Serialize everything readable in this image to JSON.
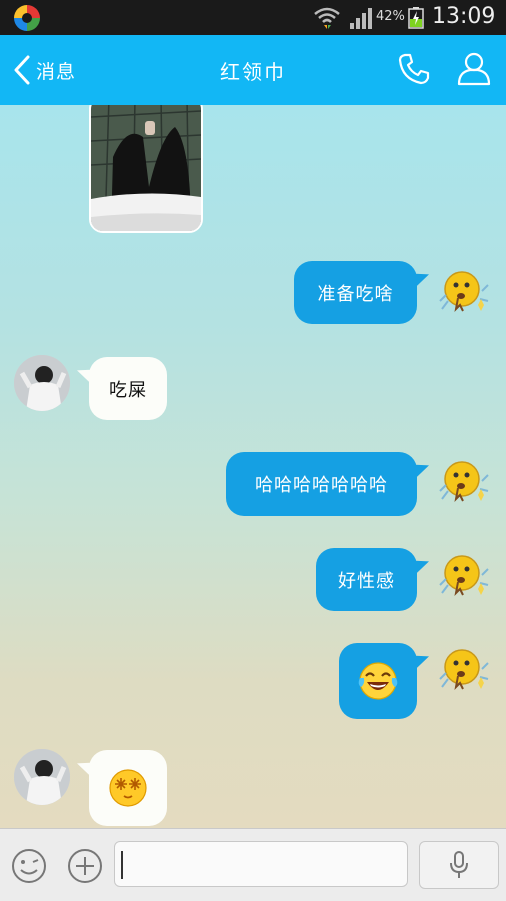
{
  "status_bar": {
    "battery_percent": "42%",
    "time": "13:09"
  },
  "nav": {
    "back_label": "消息",
    "title": "红领巾"
  },
  "messages": [
    {
      "direction": "in",
      "type": "image"
    },
    {
      "direction": "out",
      "type": "text",
      "text": "准备吃啥"
    },
    {
      "direction": "in",
      "type": "text",
      "text": "吃屎"
    },
    {
      "direction": "out",
      "type": "text",
      "text": "哈哈哈哈哈哈哈"
    },
    {
      "direction": "out",
      "type": "text",
      "text": "好性感"
    },
    {
      "direction": "out",
      "type": "emoji",
      "icon": "tears-of-joy-emoji"
    },
    {
      "direction": "in",
      "type": "emoji",
      "icon": "dizzy-face-emoji"
    }
  ],
  "input": {
    "value": "",
    "placeholder": ""
  },
  "colors": {
    "nav_bg": "#12b7f5",
    "outgoing_bubble": "#15a0e3",
    "incoming_bubble": "#fcfdf9"
  }
}
